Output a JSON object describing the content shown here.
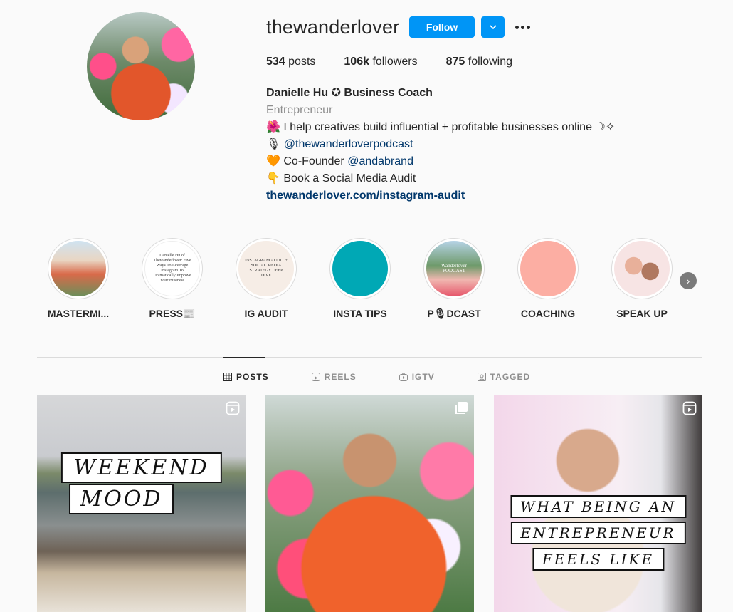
{
  "profile": {
    "username": "thewanderlover",
    "follow_label": "Follow",
    "stats": {
      "posts": "534",
      "posts_label": "posts",
      "followers": "106k",
      "followers_label": "followers",
      "following": "875",
      "following_label": "following"
    },
    "bio": {
      "name": "Danielle Hu ✪ Business Coach",
      "category": "Entrepreneur",
      "line1": "🌺 I help creatives build influential + profitable businesses online ☽✧",
      "line2_icon": "🎙",
      "line2_link": "@thewanderloverpodcast",
      "line3_icon": "🧡",
      "line3_text": "Co-Founder ",
      "line3_link": "@andabrand",
      "line4": "👇 Book a Social Media Audit",
      "url": "thewanderlover.com/instagram-audit"
    }
  },
  "highlights": [
    {
      "label": "MASTERMI...",
      "thumb_text": ""
    },
    {
      "label": "PRESS📰",
      "thumb_text": "Danielle Hu of Thewanderlover: Five Ways To Leverage Instagram To Dramatically Improve Your Business"
    },
    {
      "label": "IG AUDIT",
      "thumb_text": "INSTAGRAM AUDIT + SOCIAL MEDIA STRATEGY DEEP DIVE"
    },
    {
      "label": "INSTA TIPS",
      "thumb_text": ""
    },
    {
      "label": "P🎙DCAST",
      "thumb_text": "Wanderlover PODCAST"
    },
    {
      "label": "COACHING",
      "thumb_text": ""
    },
    {
      "label": "SPEAK UP",
      "thumb_text": ""
    }
  ],
  "tabs": [
    {
      "label": "POSTS",
      "icon": "grid-icon",
      "active": true
    },
    {
      "label": "REELS",
      "icon": "reels-icon",
      "active": false
    },
    {
      "label": "IGTV",
      "icon": "igtv-icon",
      "active": false
    },
    {
      "label": "TAGGED",
      "icon": "tagged-icon",
      "active": false
    }
  ],
  "posts": [
    {
      "caption_lines": [
        "WEEKEND",
        "MOOD"
      ],
      "type_icon": "reel-icon"
    },
    {
      "caption_lines": [],
      "type_icon": "carousel-icon"
    },
    {
      "caption_lines": [
        "WHAT BEING AN",
        "ENTREPRENEUR",
        "FEELS LIKE"
      ],
      "type_icon": "reel-icon"
    }
  ],
  "colors": {
    "accent": "#0095f6",
    "link": "#00376b",
    "muted": "#8e8e8e"
  }
}
